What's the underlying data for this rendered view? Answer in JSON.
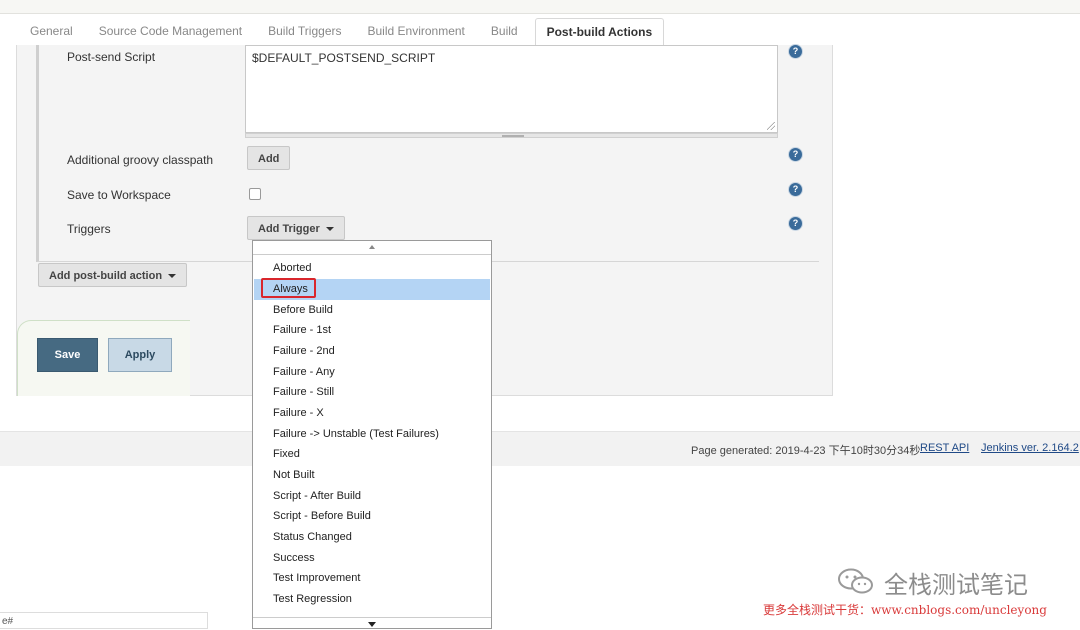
{
  "tabs": [
    "General",
    "Source Code Management",
    "Build Triggers",
    "Build Environment",
    "Build",
    "Post-build Actions"
  ],
  "active_tab": "Post-build Actions",
  "form": {
    "post_send_script_label": "Post-send Script",
    "post_send_script_value": "$DEFAULT_POSTSEND_SCRIPT",
    "groovy_classpath_label": "Additional groovy classpath",
    "add_button": "Add",
    "save_to_workspace_label": "Save to Workspace",
    "triggers_label": "Triggers",
    "add_trigger_button": "Add Trigger",
    "add_post_build_action_button": "Add post-build action"
  },
  "actions": {
    "save": "Save",
    "apply": "Apply"
  },
  "help_icon_glyph": "?",
  "trigger_menu": {
    "items": [
      "Aborted",
      "Always",
      "Before Build",
      "Failure - 1st",
      "Failure - 2nd",
      "Failure - Any",
      "Failure - Still",
      "Failure - X",
      "Failure -> Unstable (Test Failures)",
      "Fixed",
      "Not Built",
      "Script - After Build",
      "Script - Before Build",
      "Status Changed",
      "Success",
      "Test Improvement",
      "Test Regression"
    ],
    "selected": "Always",
    "highlight_color": "#d9262c"
  },
  "footer": {
    "page_generated": "Page generated: 2019-4-23 下午10时30分34秒",
    "rest_api": "REST API",
    "jenkins_version": "Jenkins ver. 2.164.2"
  },
  "bottom_input_value": "e#",
  "watermark": {
    "title": "全栈测试笔记",
    "subtitle": "更多全栈测试干货：www.cnblogs.com/uncleyong",
    "icon": "wechat-icon"
  }
}
